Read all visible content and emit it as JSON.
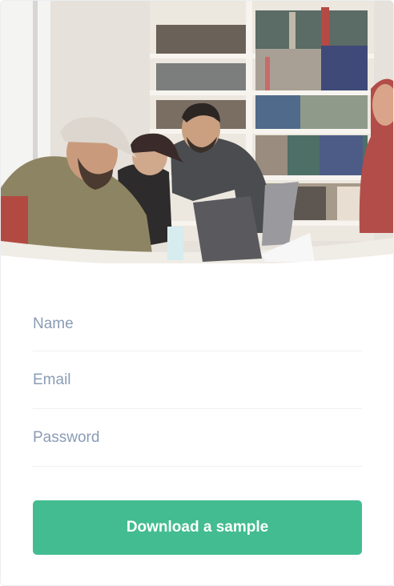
{
  "form": {
    "name": {
      "placeholder": "Name",
      "value": ""
    },
    "email": {
      "placeholder": "Email",
      "value": ""
    },
    "password": {
      "placeholder": "Password",
      "value": ""
    }
  },
  "button": {
    "label": "Download a sample"
  },
  "colors": {
    "accent": "#43bc91",
    "placeholder": "#8a9cb4",
    "divider": "#eef0f3"
  }
}
